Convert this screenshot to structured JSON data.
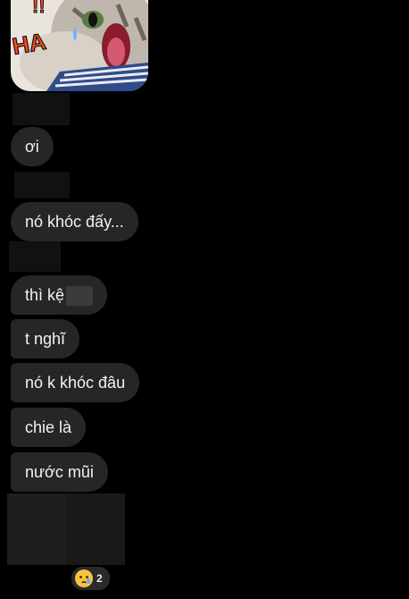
{
  "messages": [
    {
      "text": "ơi"
    },
    {
      "text": "nó khóc đấy..."
    },
    {
      "text": "thì kệ"
    },
    {
      "text": "t nghĩ"
    },
    {
      "text": "nó k khóc đâu"
    },
    {
      "text": "chie là"
    },
    {
      "text": "nước mũi"
    }
  ],
  "reaction": {
    "emoji": "crying-face-icon",
    "count": "2"
  },
  "sticker": {
    "caption": "HA"
  },
  "colors": {
    "background": "#000000",
    "bubble": "#262626",
    "text": "#f2f2f2"
  }
}
